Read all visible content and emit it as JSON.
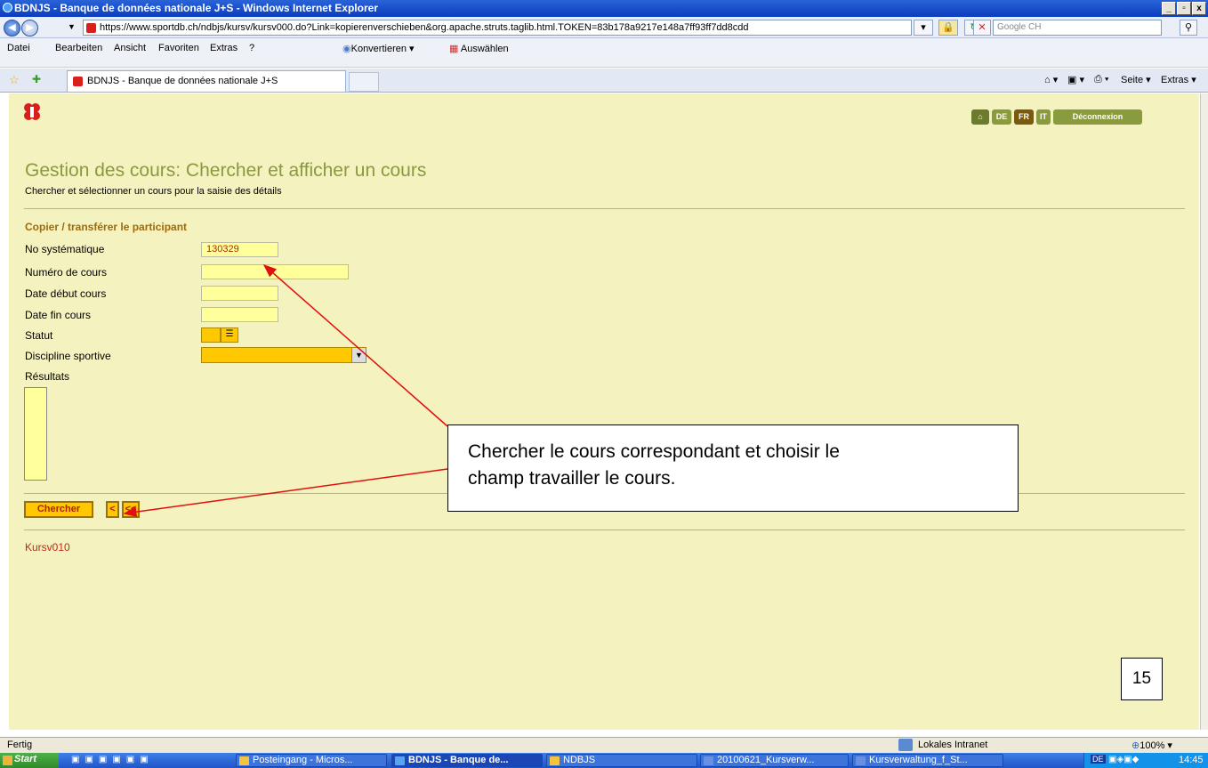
{
  "window": {
    "title": "BDNJS - Banque de données nationale J+S - Windows Internet Explorer"
  },
  "address": {
    "url": "https://www.sportdb.ch/ndbjs/kursv/kursv000.do?Link=kopierenverschieben&org.apache.struts.taglib.html.TOKEN=83b178a9217e148a7ff93ff7dd8cdd",
    "search_placeholder": "Google CH"
  },
  "menu": {
    "items": [
      "Datei",
      "Bearbeiten",
      "Ansicht",
      "Favoriten",
      "Extras",
      "?"
    ],
    "konvertieren": "Konvertieren",
    "auswaehlen": "Auswählen"
  },
  "tabs": {
    "active": "BDNJS - Banque de données nationale J+S"
  },
  "toolbar": {
    "seite": "Seite",
    "extras": "Extras"
  },
  "page": {
    "lang": {
      "de": "DE",
      "fr": "FR",
      "it": "IT",
      "logout": "Déconnexion"
    },
    "title": "Gestion des cours: Chercher et afficher un cours",
    "subtitle": "Chercher et sélectionner un cours pour la saisie des détails",
    "section": "Copier / transférer le participant",
    "fields": {
      "no_sys_label": "No systématique",
      "no_sys_value": "130329",
      "num_label": "Numéro de cours",
      "date_debut_label": "Date début cours",
      "date_fin_label": "Date fin cours",
      "statut_label": "Statut",
      "discipline_label": "Discipline sportive",
      "resultats_label": "Résultats"
    },
    "buttons": {
      "chercher": "Chercher",
      "prev": "<",
      "first": "<<"
    },
    "code": "Kursv010"
  },
  "annotation": {
    "callout_line1": "Chercher le cours correspondant et choisir le",
    "callout_line2": "champ travailler le cours.",
    "page_number": "15"
  },
  "status": {
    "left": "Fertig",
    "zone": "Lokales Intranet",
    "zoom": "100%"
  },
  "taskbar": {
    "start": "Start",
    "items": [
      "Posteingang - Micros...",
      "BDNJS - Banque de...",
      "NDBJS",
      "20100621_Kursverw...",
      "Kursverwaltung_f_St..."
    ],
    "clock": "14:45",
    "lang": "DE"
  },
  "colors": {
    "page_bg": "#f4f2be",
    "title": "#8a9a3e",
    "section": "#a06a0a",
    "arrow": "#e01010",
    "input_yellow": "#ffff9c",
    "button_orange": "#ffc800"
  }
}
